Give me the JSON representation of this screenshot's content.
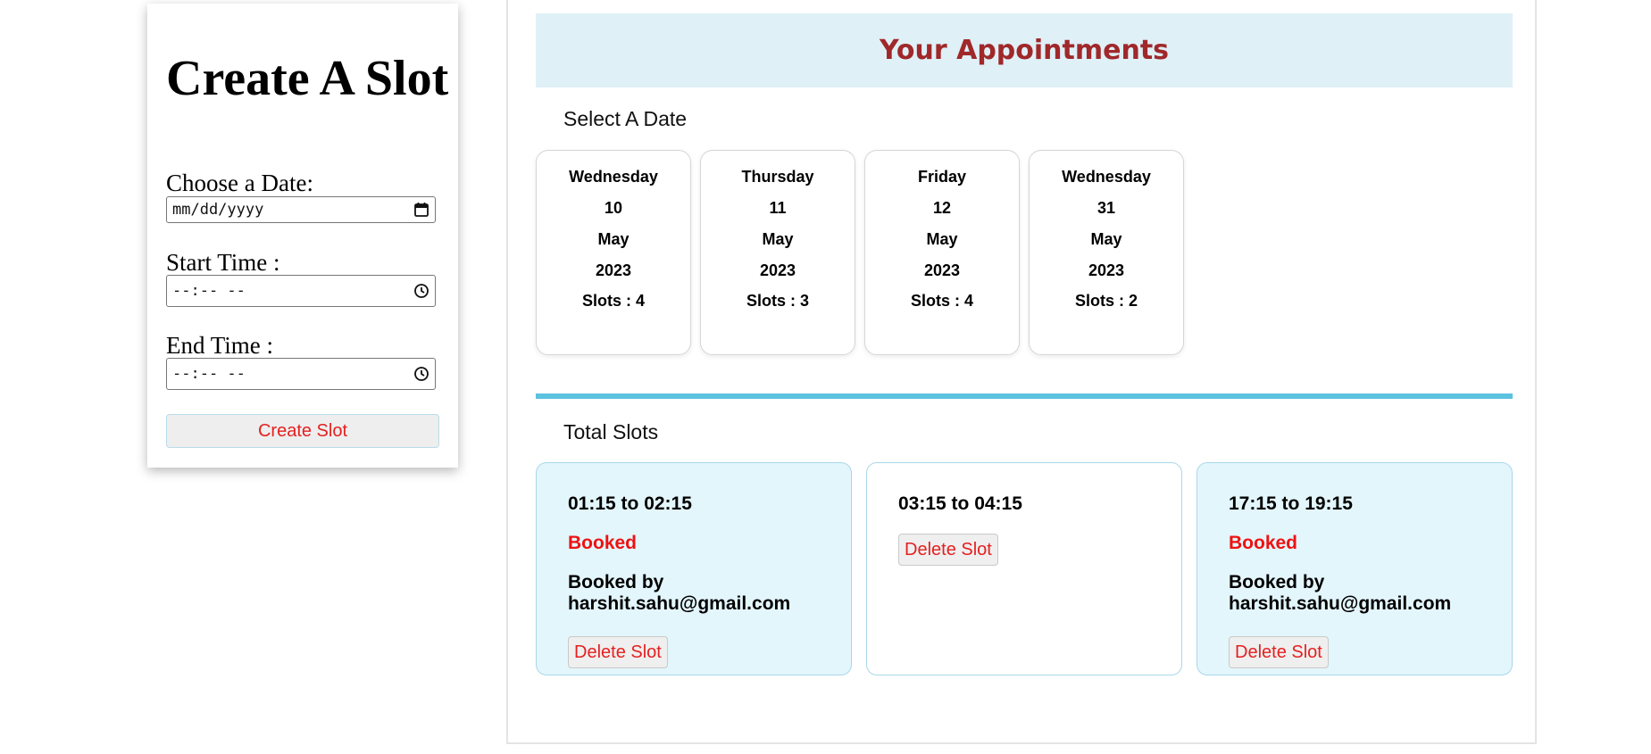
{
  "create_form": {
    "title": "Create A Slot",
    "date_label": "Choose a Date:",
    "date_placeholder": "mm/dd/yyyy",
    "start_label": "Start Time :",
    "start_placeholder": "--:-- --",
    "end_label": "End Time :",
    "end_placeholder": "--:-- --",
    "submit_label": "Create Slot"
  },
  "appointments": {
    "title": "Your Appointments",
    "select_date_label": "Select A Date",
    "dates": [
      {
        "weekday": "Wednesday",
        "day": "10",
        "month": "May",
        "year": "2023",
        "slots": "Slots : 4"
      },
      {
        "weekday": "Thursday",
        "day": "11",
        "month": "May",
        "year": "2023",
        "slots": "Slots : 3"
      },
      {
        "weekday": "Friday",
        "day": "12",
        "month": "May",
        "year": "2023",
        "slots": "Slots : 4"
      },
      {
        "weekday": "Wednesday",
        "day": "31",
        "month": "May",
        "year": "2023",
        "slots": "Slots : 2"
      }
    ],
    "total_slots_label": "Total Slots",
    "slots": [
      {
        "time": "01:15 to 02:15",
        "status": "Booked",
        "booked_by": "Booked by harshit.sahu@gmail.com",
        "delete_label": "Delete Slot"
      },
      {
        "time": "03:15 to 04:15",
        "delete_label": "Delete Slot"
      },
      {
        "time": "17:15 to 19:15",
        "status": "Booked",
        "booked_by": "Booked by harshit.sahu@gmail.com",
        "delete_label": "Delete Slot"
      }
    ]
  },
  "colors": {
    "header_bg": "#dff0f7",
    "header_text": "#a0282a",
    "divider": "#5bc2e0",
    "booked_card_bg": "#e3f6fc",
    "status_red": "#ee1212",
    "button_text_red": "#e52020"
  },
  "icons": [
    "calendar-icon",
    "clock-icon"
  ]
}
